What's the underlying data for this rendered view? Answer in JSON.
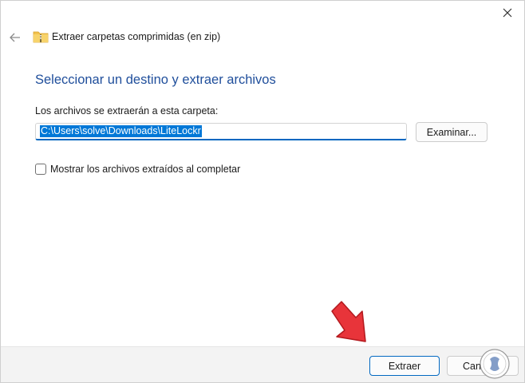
{
  "window": {
    "close_icon": "close-icon",
    "back_icon": "back-arrow-icon"
  },
  "header": {
    "title": "Extraer carpetas comprimidas (en zip)",
    "icon": "zip-folder-icon"
  },
  "main": {
    "heading": "Seleccionar un destino y extraer archivos",
    "destination_label": "Los archivos se extraerán a esta carpeta:",
    "destination_value": "C:\\Users\\solve\\Downloads\\LiteLockr",
    "browse_label": "Examinar...",
    "show_files_label": "Mostrar los archivos extraídos al completar",
    "show_files_checked": false
  },
  "footer": {
    "extract_label": "Extraer",
    "cancel_label": "Cancelar"
  },
  "colors": {
    "heading": "#1f4e9b",
    "selection": "#0078d7",
    "annotation_arrow": "#e8343a"
  }
}
